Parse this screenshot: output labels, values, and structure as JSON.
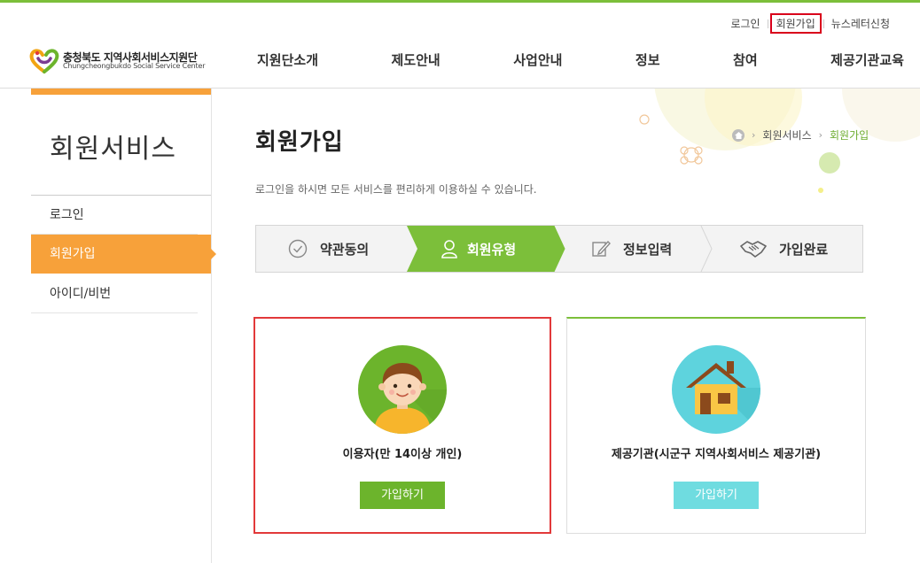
{
  "utility": {
    "login": "로그인",
    "signup": "회원가입",
    "newsletter": "뉴스레터신청"
  },
  "logo": {
    "ko": "충청북도 지역사회서비스지원단",
    "en": "Chungcheongbukdo Social Service Center"
  },
  "nav": [
    "지원단소개",
    "제도안내",
    "사업안내",
    "정보",
    "참여",
    "제공기관교육"
  ],
  "sidebar": {
    "title": "회원서비스",
    "items": [
      {
        "label": "로그인"
      },
      {
        "label": "회원가입"
      },
      {
        "label": "아이디/비번"
      }
    ]
  },
  "page": {
    "title": "회원가입",
    "intro": "로그인을 하시면 모든 서비스를 편리하게 이용하실 수 있습니다."
  },
  "breadcrumb": {
    "section": "회원서비스",
    "current": "회원가입"
  },
  "steps": [
    {
      "label": "약관동의",
      "icon": "check-circle-icon"
    },
    {
      "label": "회원유형",
      "icon": "person-icon",
      "active": true
    },
    {
      "label": "정보입력",
      "icon": "pencil-icon"
    },
    {
      "label": "가입완료",
      "icon": "handshake-icon"
    }
  ],
  "cards": {
    "user": {
      "label": "이용자(만 14이상 개인)",
      "button": "가입하기",
      "icon": "child-face-icon"
    },
    "provider": {
      "label": "제공기관(시군구 지역사회서비스 제공기관)",
      "button": "가입하기",
      "icon": "house-icon"
    }
  },
  "colors": {
    "accent_green": "#7cbf3a",
    "accent_orange": "#f7a13a",
    "highlight_red": "#e2393a",
    "provider_button": "#6fdce0"
  }
}
